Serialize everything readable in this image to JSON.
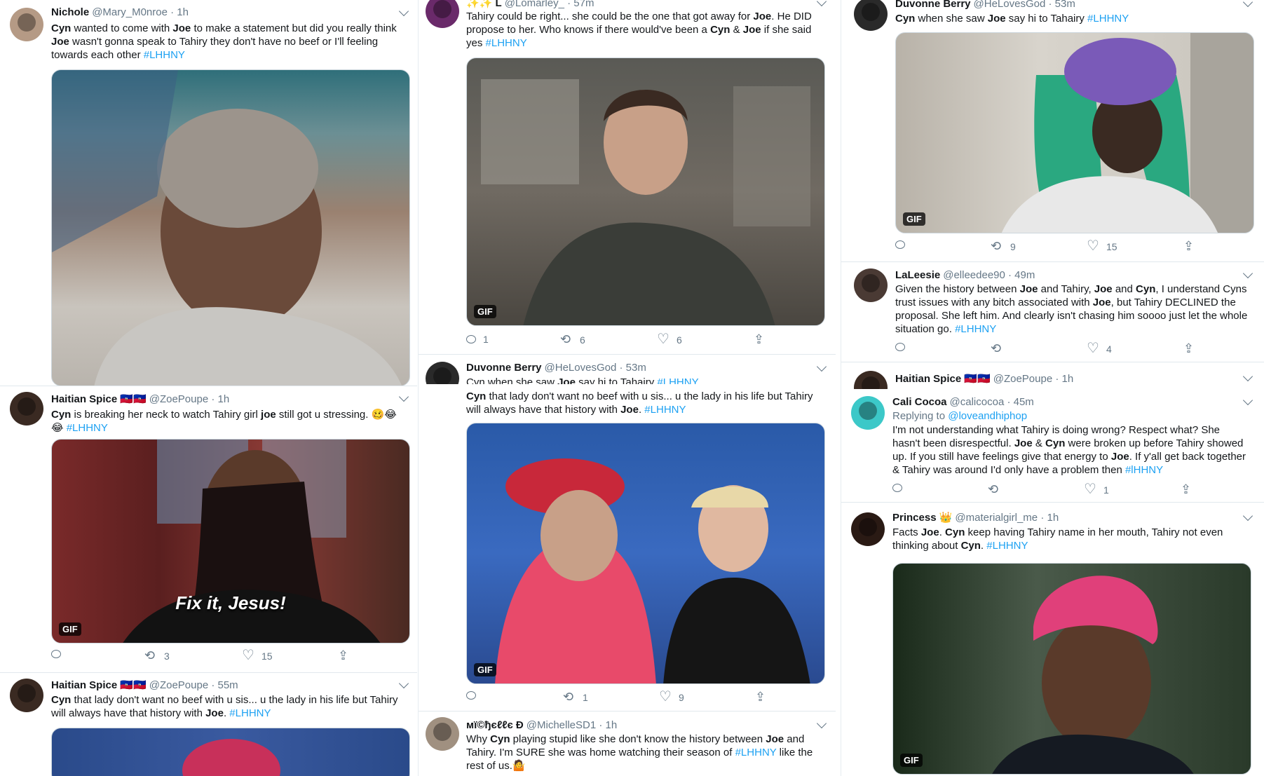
{
  "col1": {
    "t1": {
      "name": "Nichole",
      "handle": "@Mary_M0nroe · 1h",
      "text_html": "<b>Cyn</b> wanted to come with <b>Joe</b> to make a statement but did you really think <b>Joe</b> wasn't gonna speak to Tahiry they don't have no beef or I'll feeling towards each other <span class=\"tag\">#LHHNY</span>"
    },
    "t2": {
      "name": "Haitian Spice 🇭🇹🇭🇹",
      "handle": "@ZoePoupe · 1h",
      "text_html": "<b>Cyn</b> is breaking her neck to watch Tahiry girl <b>joe</b> still got u stressing. 🥴😂😂 <span class=\"tag\">#LHHNY</span>",
      "caption": "Fix it, Jesus!",
      "gif": "GIF",
      "retweets": "3",
      "likes": "15"
    },
    "t3": {
      "name": "Haitian Spice 🇭🇹🇭🇹",
      "handle": "@ZoePoupe · 55m",
      "text_html": "<b>Cyn</b> that lady don't want no beef with u sis... u the lady in his life but Tahiry will always have that history with <b>Joe</b>. <span class=\"tag\">#LHHNY</span>"
    }
  },
  "col2": {
    "t1": {
      "name": "✨✨ L",
      "handle": "@Lomarley_ · 57m",
      "text_html": "Tahiry could be right... she could be the one that got away for <b>Joe</b>. He DID propose to her.  Who knows if there would've been a <b>Cyn</b> &amp; <b>Joe</b> if she said yes <span class=\"tag\">#LHHNY</span>",
      "gif": "GIF",
      "replies": "1",
      "retweets": "6",
      "likes": "6"
    },
    "t2": {
      "name": "Duvonne Berry",
      "handle": "@HeLovesGod · 53m",
      "text_html": "Cyn when she saw <b>Joe</b> say hi to Tahairy <span class=\"tag\">#LHHNY</span>"
    },
    "t3": {
      "text_html": "<b>Cyn</b> that lady don't want no beef with u sis... u the lady in his life but Tahiry will always have that history with <b>Joe</b>.  <span class=\"tag\">#LHHNY</span>",
      "gif": "GIF",
      "retweets": "1",
      "likes": "9"
    },
    "t4": {
      "name": "мї©ђєℓℓє Đ",
      "handle": "@MichelleSD1 · 1h",
      "text_html": "Why <b>Cyn</b> playing stupid like she don't know the history between <b>Joe</b> and Tahiry. I'm SURE she was home watching their season of <span class=\"tag\">#LHHNY</span> like the rest of us.🤷"
    }
  },
  "col3": {
    "t1": {
      "name": "Duvonne Berry",
      "handle": "@HeLovesGod · 53m",
      "text_html": "<b>Cyn</b> when she saw <b>Joe</b> say hi to Tahairy <span class=\"tag\">#LHHNY</span>",
      "gif": "GIF",
      "retweets": "9",
      "likes": "15"
    },
    "t2": {
      "name": "LaLeesie",
      "handle": "@elleedee90 · 49m",
      "text_html": "Given the history between <b>Joe</b> and Tahiry, <b>Joe</b> and <b>Cyn</b>, I understand Cyns trust issues with any bitch associated with <b>Joe</b>, but Tahiry DECLINED the proposal. She left him. And clearly isn't chasing him soooo just let the whole situation go.  <span class=\"tag\">#LHHNY</span>",
      "likes": "4"
    },
    "t3": {
      "name": "Haitian Spice 🇭🇹🇭🇹",
      "handle": "@ZoePoupe · 1h"
    },
    "t4": {
      "name": "Cali Cocoa",
      "handle": "@calicocoa · 45m",
      "replying": "Replying to",
      "replying_to": "@loveandhiphop",
      "text_html": "I'm not understanding what Tahiry is doing wrong? Respect what? She hasn't been disrespectful. <b>Joe</b> &amp; <b>Cyn</b> were broken up before Tahiry showed up. If you still have feelings give that energy to <b>Joe</b>. If y'all get back together &amp; Tahiry was around I'd only have a problem then <span class=\"tag\">#lHHNY</span>",
      "likes": "1"
    },
    "t5": {
      "name": "Princess 👑",
      "handle": "@materialgirl_me · 1h",
      "text_html": "Facts <b>Joe</b>. <b>Cyn</b> keep having Tahiry name in her mouth, Tahiry not even thinking about <b>Cyn</b>. <span class=\"tag\">#LHHNY</span>",
      "gif": "GIF"
    }
  }
}
